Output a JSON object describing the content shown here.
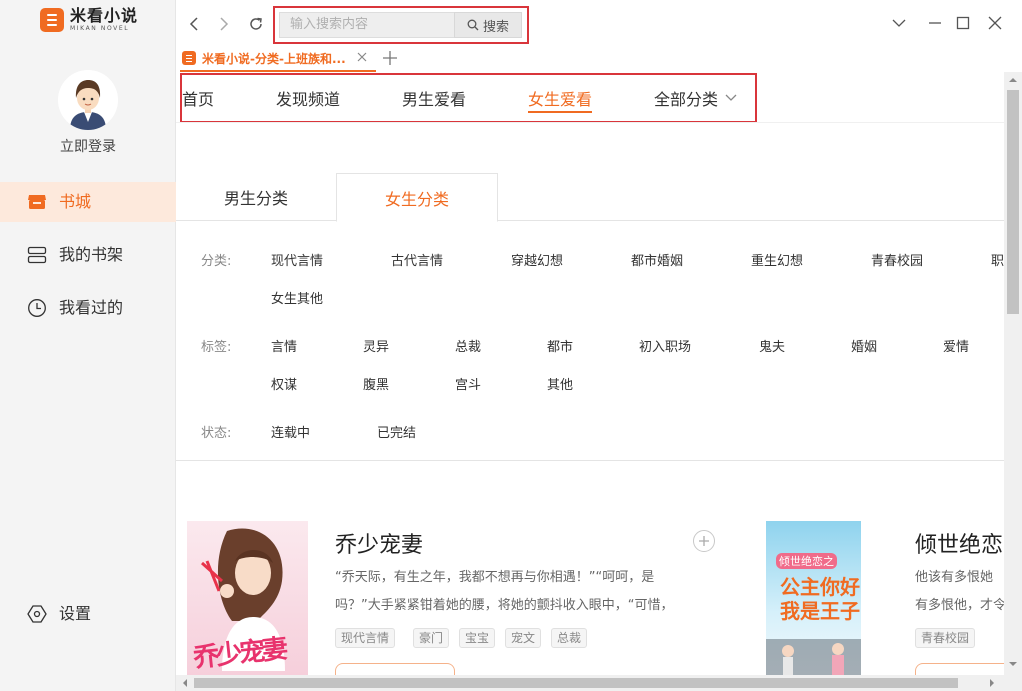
{
  "app": {
    "logo_cn": "米看小说",
    "logo_en": "MIKAN NOVEL"
  },
  "sidebar": {
    "login_label": "立即登录",
    "items": [
      {
        "label": "书城",
        "icon": "store-icon",
        "active": true
      },
      {
        "label": "我的书架",
        "icon": "bookshelf-icon",
        "active": false
      },
      {
        "label": "我看过的",
        "icon": "clock-icon",
        "active": false
      }
    ],
    "settings_label": "设置"
  },
  "toolbar": {
    "search_placeholder": "输入搜索内容",
    "search_button": "搜索"
  },
  "tabs": [
    {
      "title": "米看小说-分类-上班族和..."
    }
  ],
  "channels": {
    "items": [
      "首页",
      "发现频道",
      "男生爱看",
      "女生爱看",
      "全部分类"
    ],
    "active": "女生爱看"
  },
  "gender_tabs": {
    "male": "男生分类",
    "female": "女生分类",
    "active": "女生分类"
  },
  "filters": {
    "category_label": "分类:",
    "categories": [
      "现代言情",
      "古代言情",
      "穿越幻想",
      "都市婚姻",
      "重生幻想",
      "青春校园",
      "职",
      "女生其他"
    ],
    "tag_label": "标签:",
    "tags": [
      "言情",
      "灵异",
      "总裁",
      "都市",
      "初入职场",
      "鬼夫",
      "婚姻",
      "爱情",
      "权谋",
      "腹黑",
      "宫斗",
      "其他"
    ],
    "status_label": "状态:",
    "statuses": [
      "连载中",
      "已完结"
    ]
  },
  "books": [
    {
      "title": "乔少宠妻",
      "desc_line1": "“乔天际，有生之年，我都不想再与你相遇！”“呵呵，是",
      "desc_line2": "吗？”大手紧紧钳着她的腰，将她的颤抖收入眼中，“可惜，",
      "tags": [
        "现代言情",
        "豪门",
        "宝宝",
        "宠文",
        "总裁"
      ],
      "cover_text": "乔少宠妻"
    },
    {
      "title": "倾世绝恋",
      "desc_line1": "他该有多恨她",
      "desc_line2": "有多恨他，才令",
      "tags": [
        "青春校园"
      ],
      "cover_line1": "倾世绝恋之",
      "cover_line2": "公主你好",
      "cover_line3": "我是王子"
    }
  ],
  "colors": {
    "accent": "#f06b21",
    "highlight_box": "#d9353b",
    "sidebar_bg": "#f4f4f4",
    "active_nav_bg": "#fde9dc"
  }
}
